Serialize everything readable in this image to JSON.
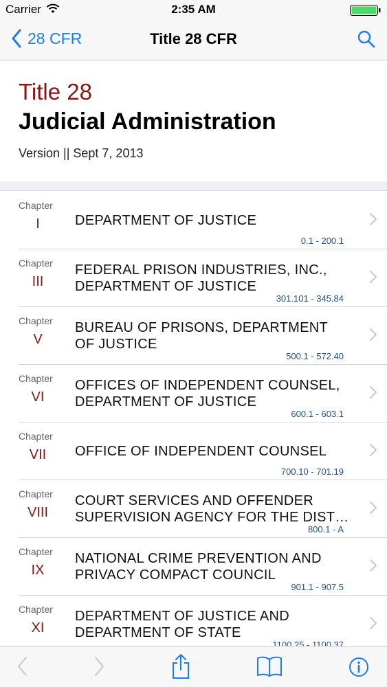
{
  "status_bar": {
    "carrier": "Carrier",
    "time": "2:35 AM"
  },
  "nav": {
    "back_label": "28 CFR",
    "title": "Title 28 CFR"
  },
  "header": {
    "title": "Title 28",
    "subtitle": "Judicial Administration",
    "version": "Version || Sept 7, 2013"
  },
  "chapter_label": "Chapter",
  "chapters": [
    {
      "numeral": "I",
      "name": [
        "DEPARTMENT OF JUSTICE"
      ],
      "range": "0.1 - 200.1"
    },
    {
      "numeral": "III",
      "name": [
        "FEDERAL PRISON INDUSTRIES, INC.,",
        "DEPARTMENT OF JUSTICE"
      ],
      "range": "301.101 - 345.84"
    },
    {
      "numeral": "V",
      "name": [
        "BUREAU OF PRISONS, DEPARTMENT",
        "OF JUSTICE"
      ],
      "range": "500.1 - 572.40"
    },
    {
      "numeral": "VI",
      "name": [
        "OFFICES OF INDEPENDENT COUNSEL,",
        "DEPARTMENT OF JUSTICE"
      ],
      "range": "600.1 - 603.1"
    },
    {
      "numeral": "VII",
      "name": [
        "OFFICE OF INDEPENDENT COUNSEL"
      ],
      "range": "700.10 - 701.19"
    },
    {
      "numeral": "VIII",
      "name": [
        "COURT SERVICES AND OFFENDER",
        "SUPERVISION AGENCY FOR THE DIST…"
      ],
      "range": "800.1 - A"
    },
    {
      "numeral": "IX",
      "name": [
        "NATIONAL CRIME PREVENTION AND",
        "PRIVACY COMPACT COUNCIL"
      ],
      "range": "901.1 - 907.5"
    },
    {
      "numeral": "XI",
      "name": [
        "DEPARTMENT OF JUSTICE AND",
        "DEPARTMENT OF STATE"
      ],
      "range": "1100.25 - 1100.37"
    }
  ],
  "colors": {
    "accent": "#1a7bf5",
    "title_red": "#8b1515",
    "range_blue": "#1f4f8a"
  },
  "toolbar": {
    "icons": [
      "back-arrow-icon",
      "forward-arrow-icon",
      "share-icon",
      "bookmarks-icon",
      "info-icon"
    ]
  }
}
